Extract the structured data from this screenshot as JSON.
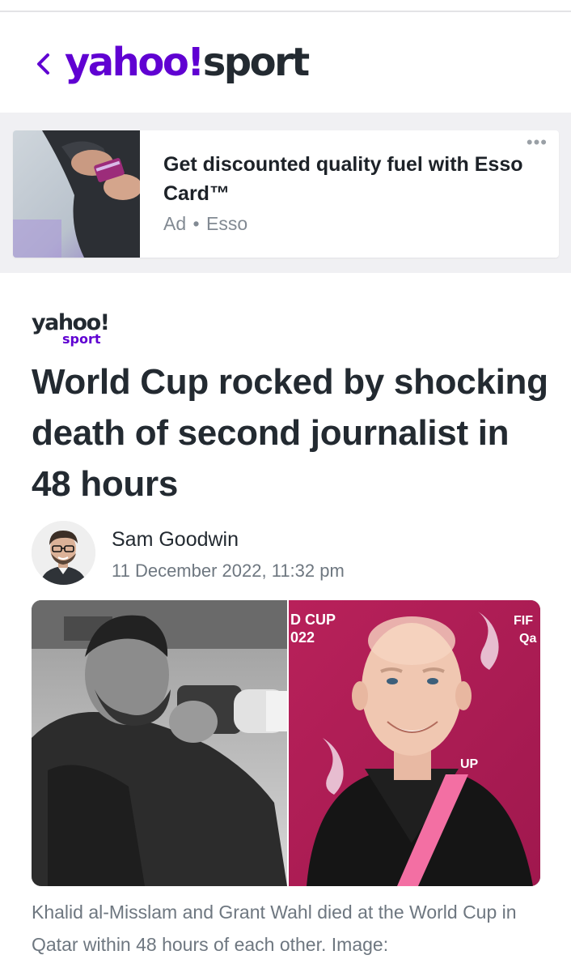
{
  "header": {
    "back_icon": "chevron-left-icon",
    "logo": {
      "yahoo": "yahoo!",
      "sport": "sport"
    },
    "brand_color": "#6001d2"
  },
  "ad": {
    "title": "Get discounted quality fuel with Esso Card™",
    "label": "Ad",
    "separator": "•",
    "advertiser": "Esso",
    "more_icon": "more-horizontal-icon"
  },
  "article": {
    "brand": {
      "yahoo": "yahoo!",
      "sport": "sport"
    },
    "headline": "World Cup rocked by shocking death of second journalist in 48 hours",
    "author": "Sam Goodwin",
    "date": "11 December 2022, 11:32 pm",
    "image_text": {
      "left": "D CUP",
      "left_year": "022",
      "right": "FIF",
      "right2": "Qa",
      "band": "UP"
    },
    "caption": "Khalid al-Misslam and Grant Wahl died at the World Cup in Qatar within 48 hours of each other. Image:"
  }
}
